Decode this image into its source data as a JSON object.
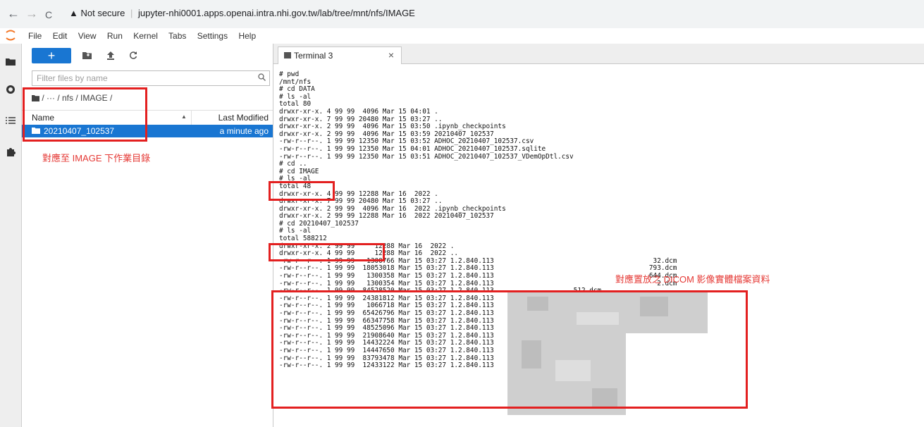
{
  "browser": {
    "back": "←",
    "forward": "→",
    "reload": "C",
    "security": "▲ Not secure",
    "sep": "|",
    "url": "jupyter-nhi0001.apps.openai.intra.nhi.gov.tw/lab/tree/mnt/nfs/IMAGE"
  },
  "menu": [
    "File",
    "Edit",
    "View",
    "Run",
    "Kernel",
    "Tabs",
    "Settings",
    "Help"
  ],
  "file_browser": {
    "new_label": "+",
    "filter_placeholder": "Filter files by name",
    "breadcrumb": "/ ··· / nfs / IMAGE /",
    "col_name": "Name",
    "col_modified": "Last Modified",
    "rows": [
      {
        "name": "20210407_102537",
        "modified": "a minute ago"
      }
    ]
  },
  "annotations": {
    "left": "對應至 IMAGE 下作業目錄",
    "right": "對應置放之 DICOM 影像實體檔案資料"
  },
  "terminal": {
    "tab_label": "Terminal 3",
    "close": "×",
    "lines": [
      "# pwd",
      "/mnt/nfs",
      "# cd DATA",
      "# ls -al",
      "total 80",
      "drwxr-xr-x. 4 99 99  4096 Mar 15 04:01 .",
      "drwxr-xr-x. 7 99 99 20480 Mar 15 03:27 ..",
      "drwxr-xr-x. 2 99 99  4096 Mar 15 03:50 .ipynb_checkpoints",
      "drwxr-xr-x. 2 99 99  4096 Mar 15 03:59 20210407_102537",
      "-rw-r--r--. 1 99 99 12350 Mar 15 03:52 ADHOC_20210407_102537.csv",
      "-rw-r--r--. 1 99 99 12350 Mar 15 04:01 ADHOC_20210407_102537.sqlite",
      "-rw-r--r--. 1 99 99 12350 Mar 15 03:51 ADHOC_20210407_102537_VDemOpDtl.csv",
      "# cd ..",
      "# cd IMAGE",
      "# ls -al",
      "total 48",
      "drwxr-xr-x. 4 99 99 12288 Mar 16  2022 .",
      "drwxr-xr-x. 7 99 99 20480 Mar 15 03:27 ..",
      "drwxr-xr-x. 2 99 99  4096 Mar 16  2022 .ipynb_checkpoints",
      "drwxr-xr-x. 2 99 99 12288 Mar 16  2022 20210407_102537",
      "# cd 20210407_102537",
      "# ls -al",
      "total 588212",
      "drwxr-xr-x. 2 99 99     12288 Mar 16  2022 .",
      "drwxr-xr-x. 4 99 99     12288 Mar 16  2022 ..",
      "-rw-r--r--. 1 99 99   1300766 Mar 15 03:27 1.2.840.113                                        32.dcm",
      "-rw-r--r--. 1 99 99  18053018 Mar 15 03:27 1.2.840.113                                       793.dcm",
      "-rw-r--r--. 1 99 99   1300358 Mar 15 03:27 1.2.840.113                                       644.dcm",
      "-rw-r--r--. 1 99 99   1300354 Mar 15 03:27 1.2.840.113                                         2.dcm",
      "-rw-r--r--. 1 99 99  84528520 Mar 15 03:27 1.2.840.113                   .512.dcm",
      "-rw-r--r--. 1 99 99  24381812 Mar 15 03:27 1.2.840.113                   .512.dcm",
      "-rw-r--r--. 1 99 99   1066718 Mar 15 03:27 1.2.840.113                   .dcm",
      "-rw-r--r--. 1 99 99  65426796 Mar 15 03:27 1.2.840.113                   .512.dcm",
      "-rw-r--r--. 1 99 99  66347758 Mar 15 03:27 1.2.840.113                   .512.dcm",
      "-rw-r--r--. 1 99 99  48525096 Mar 15 03:27 1.2.840.113                   .512.dcm",
      "-rw-r--r--. 1 99 99  21908640 Mar 15 03:27 1.2.840.113                   512.dcm",
      "-rw-r--r--. 1 99 99  14432224 Mar 15 03:27 1.2.840.113                   dcm",
      "-rw-r--r--. 1 99 99  14447650 Mar 15 03:27 1.2.840.113                   dcm",
      "-rw-r--r--. 1 99 99  83793478 Mar 15 03:27 1.2.840.113                   .12.dcm",
      "-rw-r--r--. 1 99 99  12433122 Mar 15 03:27 1.2.840.113                   .12.dcm"
    ]
  },
  "colors": {
    "accent": "#1976d2",
    "annotation": "#e53935"
  },
  "icons": [
    "back-arrow-icon",
    "forward-arrow-icon",
    "reload-icon",
    "jupyter-logo",
    "folder-icon",
    "new-folder-icon",
    "upload-icon",
    "refresh-icon",
    "search-icon",
    "running-icon",
    "commands-icon",
    "extensions-icon",
    "terminal-icon",
    "close-icon"
  ]
}
